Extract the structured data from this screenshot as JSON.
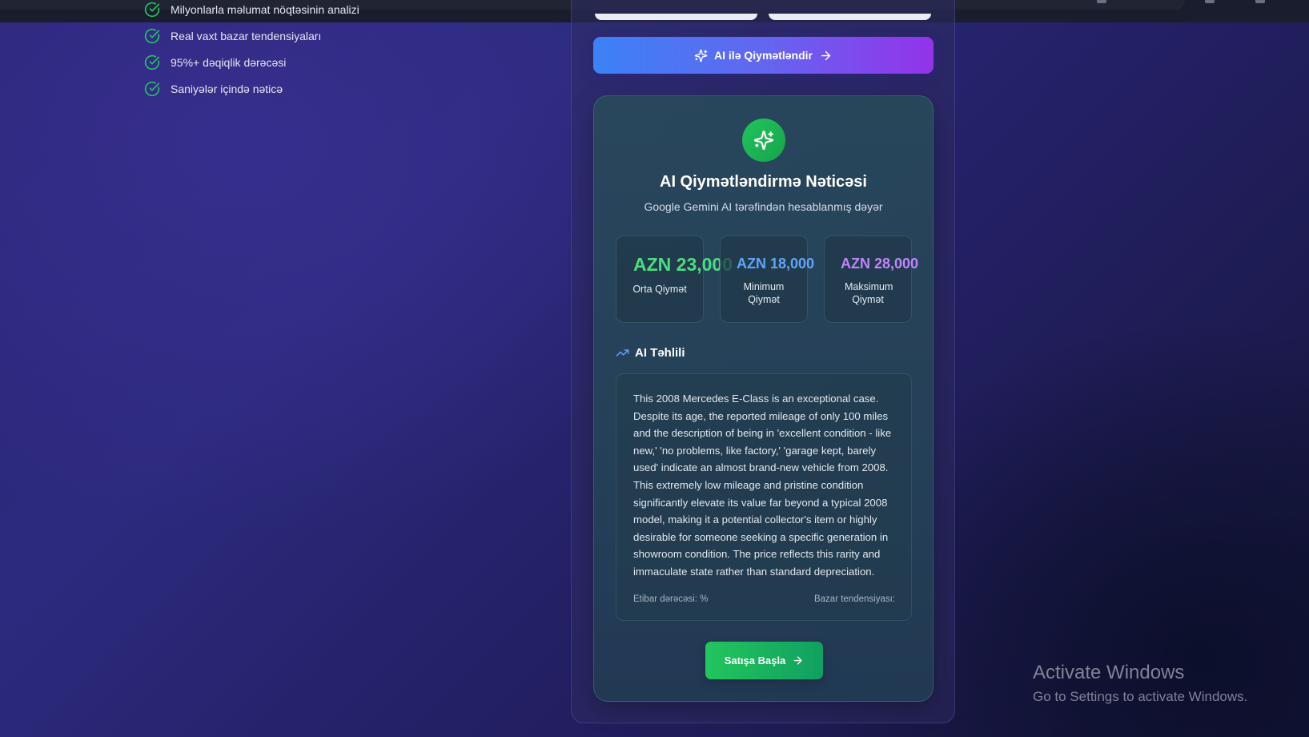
{
  "features": [
    {
      "label": "Milyonlarla məlumat nöqtəsinin analizi"
    },
    {
      "label": "Real vaxt bazar tendensiyaları"
    },
    {
      "label": "95%+ dəqiqlik dərəcəsi"
    },
    {
      "label": "Saniyələr içində nəticə"
    }
  ],
  "ai_button": {
    "label": "AI ilə Qiymətləndir"
  },
  "result": {
    "title": "AI Qiymətləndirmə Nəticəsi",
    "subtitle": "Google Gemini AI tərəfindən hesablanmış dəyər",
    "stats": [
      {
        "value": "AZN 23,000",
        "label": "Orta Qiymət",
        "color": "#4ade80"
      },
      {
        "value": "AZN 18,000",
        "label": "Minimum Qiymət",
        "color": "#60a5fa"
      },
      {
        "value": "AZN 28,000",
        "label": "Maksimum Qiymət",
        "color": "#c084fc"
      }
    ],
    "analysis_title": "AI Təhlili",
    "analysis_text": "This 2008 Mercedes E-Class is an exceptional case. Despite its age, the reported mileage of only 100 miles and the description of being in 'excellent condition - like new,' 'no problems, like factory,' 'garage kept, barely used' indicate an almost brand-new vehicle from 2008. This extremely low mileage and pristine condition significantly elevate its value far beyond a typical 2008 model, making it a potential collector's item or highly desirable for someone seeking a specific generation in showroom condition. The price reflects this rarity and immaculate state rather than standard depreciation.",
    "confidence_label": "Etibar dərəcəsi: %",
    "trend_label": "Bazar tendensiyası:",
    "start_button": "Satışa Başla"
  },
  "watermark": {
    "title": "Activate Windows",
    "subtitle": "Go to Settings to activate Windows."
  },
  "colors": {
    "accent_blue": "#3b82f6",
    "accent_purple": "#9333ea",
    "success_green": "#22c55e"
  },
  "icons": [
    "check-circle-icon",
    "sparkles-icon",
    "arrow-right-icon",
    "trending-up-icon"
  ]
}
